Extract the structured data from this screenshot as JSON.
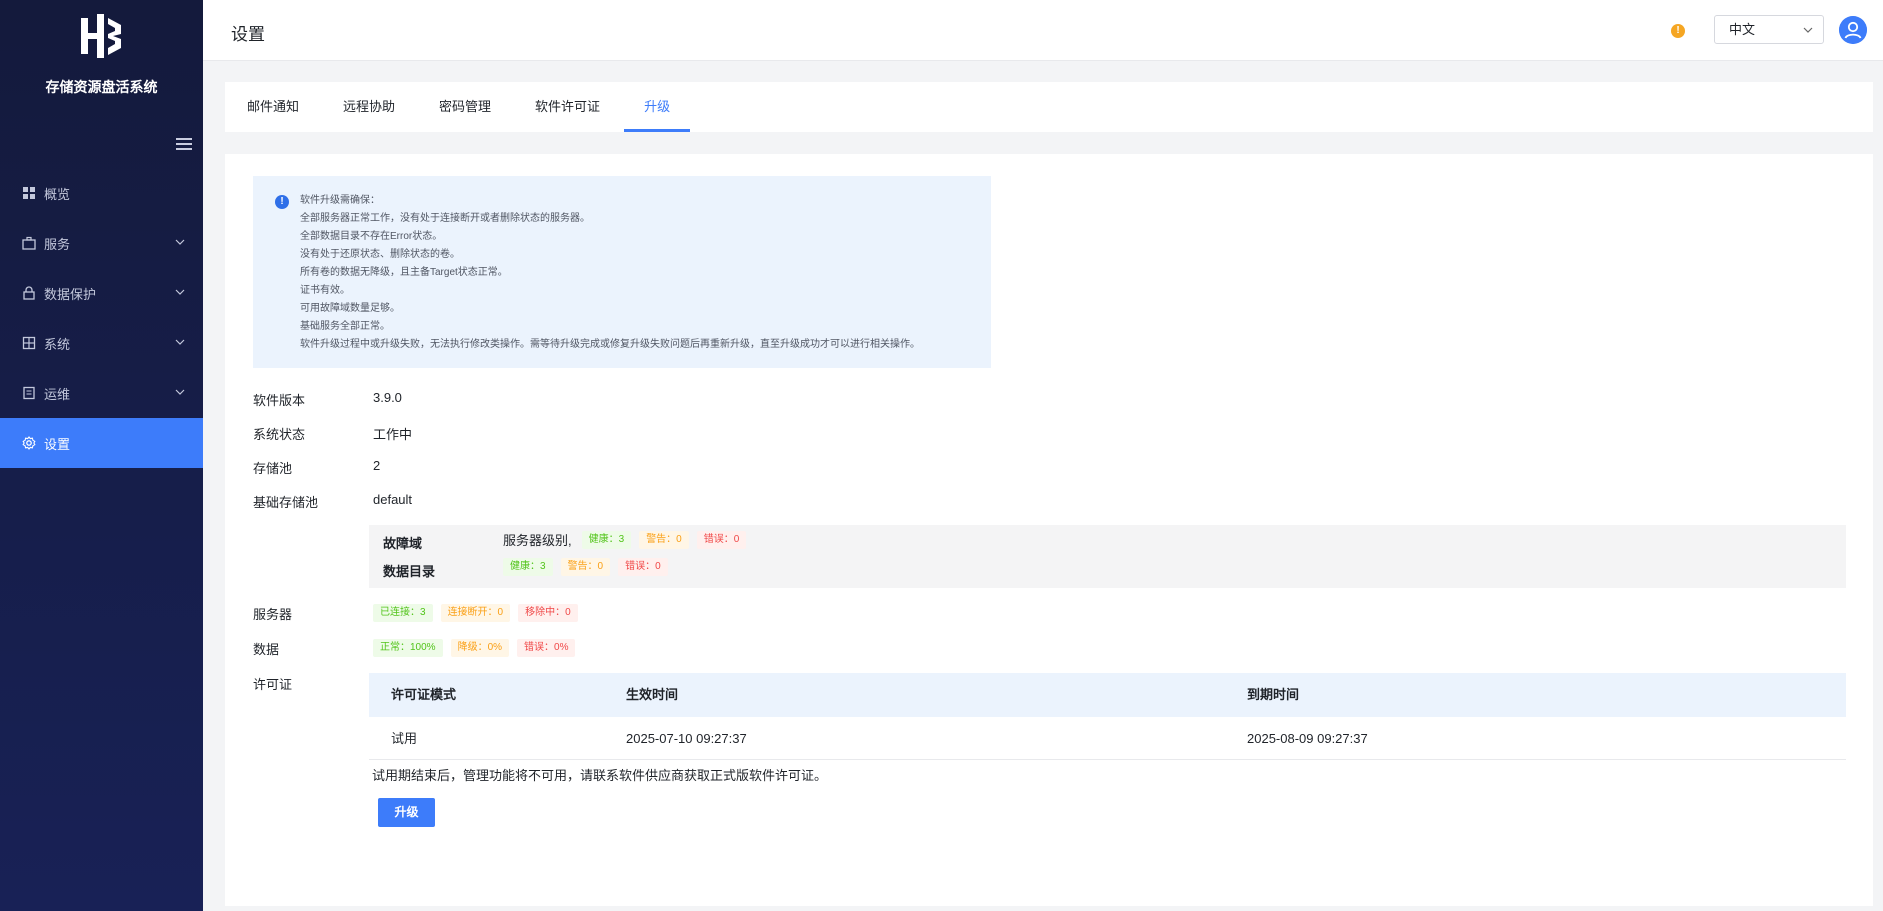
{
  "app": {
    "name": "存储资源盘活系统"
  },
  "sidebar": {
    "items": [
      {
        "label": "概览",
        "icon": "grid-icon"
      },
      {
        "label": "服务",
        "icon": "briefcase-icon"
      },
      {
        "label": "数据保护",
        "icon": "lock-icon"
      },
      {
        "label": "系统",
        "icon": "building-icon"
      },
      {
        "label": "运维",
        "icon": "clipboard-icon"
      },
      {
        "label": "设置",
        "icon": "gear-icon"
      }
    ]
  },
  "header": {
    "title": "设置",
    "language": "中文",
    "alert_symbol": "!"
  },
  "tabs": [
    "邮件通知",
    "远程协助",
    "密码管理",
    "软件许可证",
    "升级"
  ],
  "notice": {
    "icon_symbol": "!",
    "lines": [
      "软件升级需确保：",
      "全部服务器正常工作，没有处于连接断开或者删除状态的服务器。",
      "全部数据目录不存在Error状态。",
      "没有处于还原状态、删除状态的卷。",
      "所有卷的数据无降级，且主备Target状态正常。",
      "证书有效。",
      "可用故障域数量足够。",
      "基础服务全部正常。",
      "软件升级过程中或升级失败，无法执行修改类操作。需等待升级完成或修复升级失败问题后再重新升级，直至升级成功才可以进行相关操作。"
    ]
  },
  "info": {
    "version_label": "软件版本",
    "version": "3.9.0",
    "status_label": "系统状态",
    "status": "工作中",
    "pool_label": "存储池",
    "pool": "2",
    "base_pool_label": "基础存储池",
    "base_pool": "default"
  },
  "fault_domain": {
    "label": "故障域",
    "level": "服务器级别,",
    "healthy": "健康：3",
    "warning": "警告：0",
    "error": "错误：0"
  },
  "data_dir": {
    "label": "数据目录",
    "healthy": "健康：3",
    "warning": "警告：0",
    "error": "错误：0"
  },
  "servers": {
    "label": "服务器",
    "connected": "已连接：3",
    "disconnected": "连接断开：0",
    "removing": "移除中：0"
  },
  "data": {
    "label": "数据",
    "normal": "正常：100%",
    "degraded": "降级：0%",
    "error": "错误：0%"
  },
  "license": {
    "label": "许可证",
    "columns": [
      "许可证模式",
      "生效时间",
      "到期时间"
    ],
    "row": [
      "试用",
      "2025-07-10 09:27:37",
      "2025-08-09 09:27:37"
    ],
    "note": "试用期结束后，管理功能将不可用，请联系软件供应商获取正式版软件许可证。"
  },
  "upgrade_button": "升级"
}
